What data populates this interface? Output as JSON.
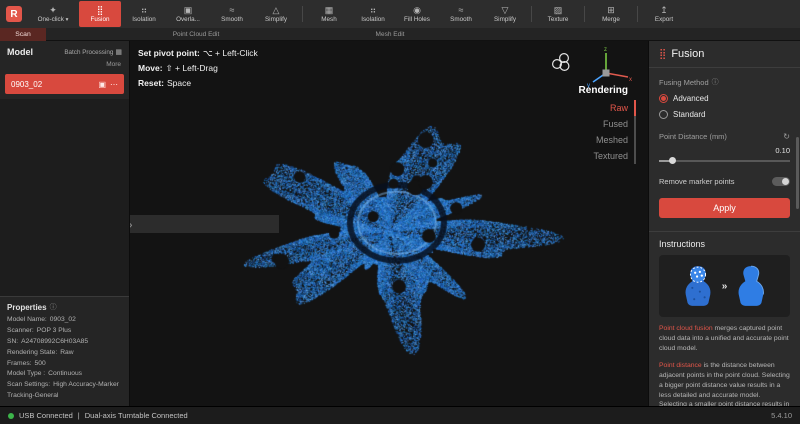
{
  "colors": {
    "accent": "#d8493e",
    "cloud_blue": "#2b7fd4",
    "status_green": "#3cb54a"
  },
  "toolbar": {
    "logo_letter": "R",
    "scan_tab": "Scan",
    "group_labels": [
      "Point Cloud Edit",
      "Mesh Edit"
    ],
    "buttons": [
      {
        "label": "One-click",
        "icon": "✦",
        "dropdown": "▾"
      },
      {
        "label": "Fusion",
        "icon": "⣿"
      },
      {
        "label": "Isolation",
        "icon": "⠶"
      },
      {
        "label": "Overla...",
        "icon": "▣"
      },
      {
        "label": "Smooth",
        "icon": "≈"
      },
      {
        "label": "Simplify",
        "icon": "△"
      },
      {
        "label": "Mesh",
        "icon": "▦"
      },
      {
        "label": "Isolation",
        "icon": "⠶"
      },
      {
        "label": "Fill Holes",
        "icon": "◉"
      },
      {
        "label": "Smooth",
        "icon": "≈"
      },
      {
        "label": "Simplify",
        "icon": "▽"
      },
      {
        "label": "Texture",
        "icon": "▨"
      },
      {
        "label": "Merge",
        "icon": "⊞"
      },
      {
        "label": "Export",
        "icon": "↥"
      }
    ]
  },
  "model_panel": {
    "title": "Model",
    "batch_processing": "Batch Processing",
    "more": "More",
    "item": {
      "name": "0903_02"
    }
  },
  "properties": {
    "title": "Properties",
    "rows": [
      {
        "label": "Model Name:",
        "value": "0903_02"
      },
      {
        "label": "Scanner:",
        "value": "POP 3 Plus"
      },
      {
        "label": "SN:",
        "value": "A24708992C6H03A85"
      },
      {
        "label": "Rendering State:",
        "value": "Raw"
      },
      {
        "label": "Frames:",
        "value": "500"
      },
      {
        "label": "Model Type :",
        "value": "Continuous"
      },
      {
        "label": "Scan Settings:",
        "value": "High Accuracy-Marker Tracking-General"
      }
    ]
  },
  "viewport": {
    "hints": [
      {
        "label": "Set pivot point:",
        "value": "⌥ + Left-Click"
      },
      {
        "label": "Move:",
        "value": "⇧ + Left-Drag"
      },
      {
        "label": "Reset:",
        "value": "Space"
      }
    ],
    "rendering_title": "Rendering",
    "rendering_options": [
      {
        "label": "Raw",
        "active": true
      },
      {
        "label": "Fused",
        "active": false
      },
      {
        "label": "Meshed",
        "active": false
      },
      {
        "label": "Textured",
        "active": false
      }
    ],
    "axis": {
      "x": "x",
      "y": "y",
      "z": "z"
    }
  },
  "fusion_panel": {
    "title": "Fusion",
    "fusing_method_label": "Fusing Method",
    "method_advanced": "Advanced",
    "method_standard": "Standard",
    "point_distance_label": "Point Distance (mm)",
    "point_distance_value": "0.10",
    "remove_marker_label": "Remove marker points",
    "remove_marker_on": false,
    "apply_label": "Apply",
    "instructions_title": "Instructions",
    "arrows": "»",
    "p1_highlight": "Point cloud fusion",
    "p1_rest": " merges captured point cloud data into a unified and accurate point cloud model.",
    "p2_highlight": "Point distance",
    "p2_rest": " is the distance between adjacent points in the point cloud. Selecting a bigger point distance value results in a less detailed and accurate model. Selecting a smaller point distance results in a more detailed and accurate model but also increases the model's file"
  },
  "statusbar": {
    "usb": "USB Connected",
    "sep": "|",
    "turntable": "Dual-axis Turntable Connected",
    "version": "5.4.10"
  },
  "icons": {
    "info": "ⓘ",
    "refresh": "↻",
    "ellipsis": "⋯",
    "card": "▣",
    "batch": "▦",
    "chevron_left": "‹",
    "chevron_right": "›"
  }
}
